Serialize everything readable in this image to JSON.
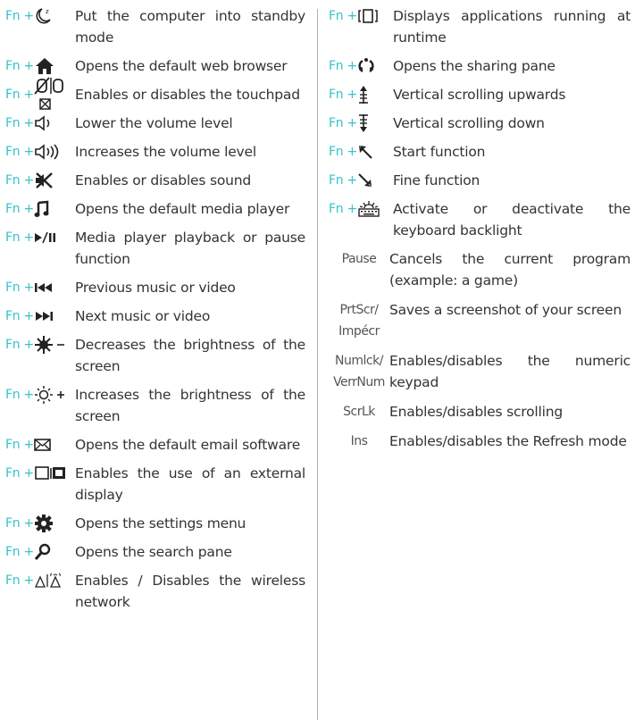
{
  "fn_label": "Fn +",
  "left": [
    {
      "icon": "standby-moon-icon",
      "desc": "Put the computer into standby mode"
    },
    {
      "icon": "home-icon",
      "desc": "Opens the default web browser"
    },
    {
      "icon": "touchpad-icon",
      "desc": "Enables or disables the touchpad"
    },
    {
      "icon": "volume-down-icon",
      "desc": "Lower the volume level"
    },
    {
      "icon": "volume-up-icon",
      "desc": "Increases the volume level"
    },
    {
      "icon": "mute-icon",
      "desc": "Enables or disables sound"
    },
    {
      "icon": "music-note-icon",
      "desc": "Opens the default media player"
    },
    {
      "icon": "play-pause-icon",
      "desc": "Media player playback or pause function"
    },
    {
      "icon": "previous-track-icon",
      "desc": "Previous music or video"
    },
    {
      "icon": "next-track-icon",
      "desc": "Next music or video"
    },
    {
      "icon": "brightness-down-icon",
      "desc": "Decreases the brightness of the screen"
    },
    {
      "icon": "brightness-up-icon",
      "desc": "Increases the brightness of the screen"
    },
    {
      "icon": "mail-icon",
      "desc": "Opens the default email software"
    },
    {
      "icon": "external-display-icon",
      "desc": "Enables the use of an external display"
    },
    {
      "icon": "settings-gear-icon",
      "desc": "Opens the settings menu"
    },
    {
      "icon": "search-icon",
      "desc": "Opens the search pane"
    },
    {
      "icon": "wireless-icon",
      "desc": "Enables / Disables the wireless network"
    }
  ],
  "right_fn": [
    {
      "icon": "running-apps-icon",
      "desc": "Displays applications running at runtime"
    },
    {
      "icon": "share-icon",
      "desc": "Opens the sharing pane"
    },
    {
      "icon": "scroll-up-icon",
      "desc": "Vertical scrolling upwards"
    },
    {
      "icon": "scroll-down-icon",
      "desc": "Vertical scrolling down"
    },
    {
      "icon": "home-arrow-icon",
      "desc": "Start function"
    },
    {
      "icon": "end-arrow-icon",
      "desc": "Fine function"
    },
    {
      "icon": "keyboard-backlight-icon",
      "desc": "Activate or deactivate the keyboard backlight"
    }
  ],
  "right_keys": [
    {
      "key_line1": "Pause",
      "key_line2": "",
      "desc": "Cancels the current program (example: a game)"
    },
    {
      "key_line1": "PrtScr/",
      "key_line2": "Impécr",
      "desc": "Saves a screenshot of your screen"
    },
    {
      "key_line1": "Numlck/",
      "key_line2": "VerrNum",
      "desc": "Enables/disables the numeric keypad"
    },
    {
      "key_line1": "ScrLk",
      "key_line2": "",
      "desc": "Enables/disables scrolling"
    },
    {
      "key_line1": "Ins",
      "key_line2": "",
      "desc": "Enables/disables the Refresh mode"
    }
  ]
}
